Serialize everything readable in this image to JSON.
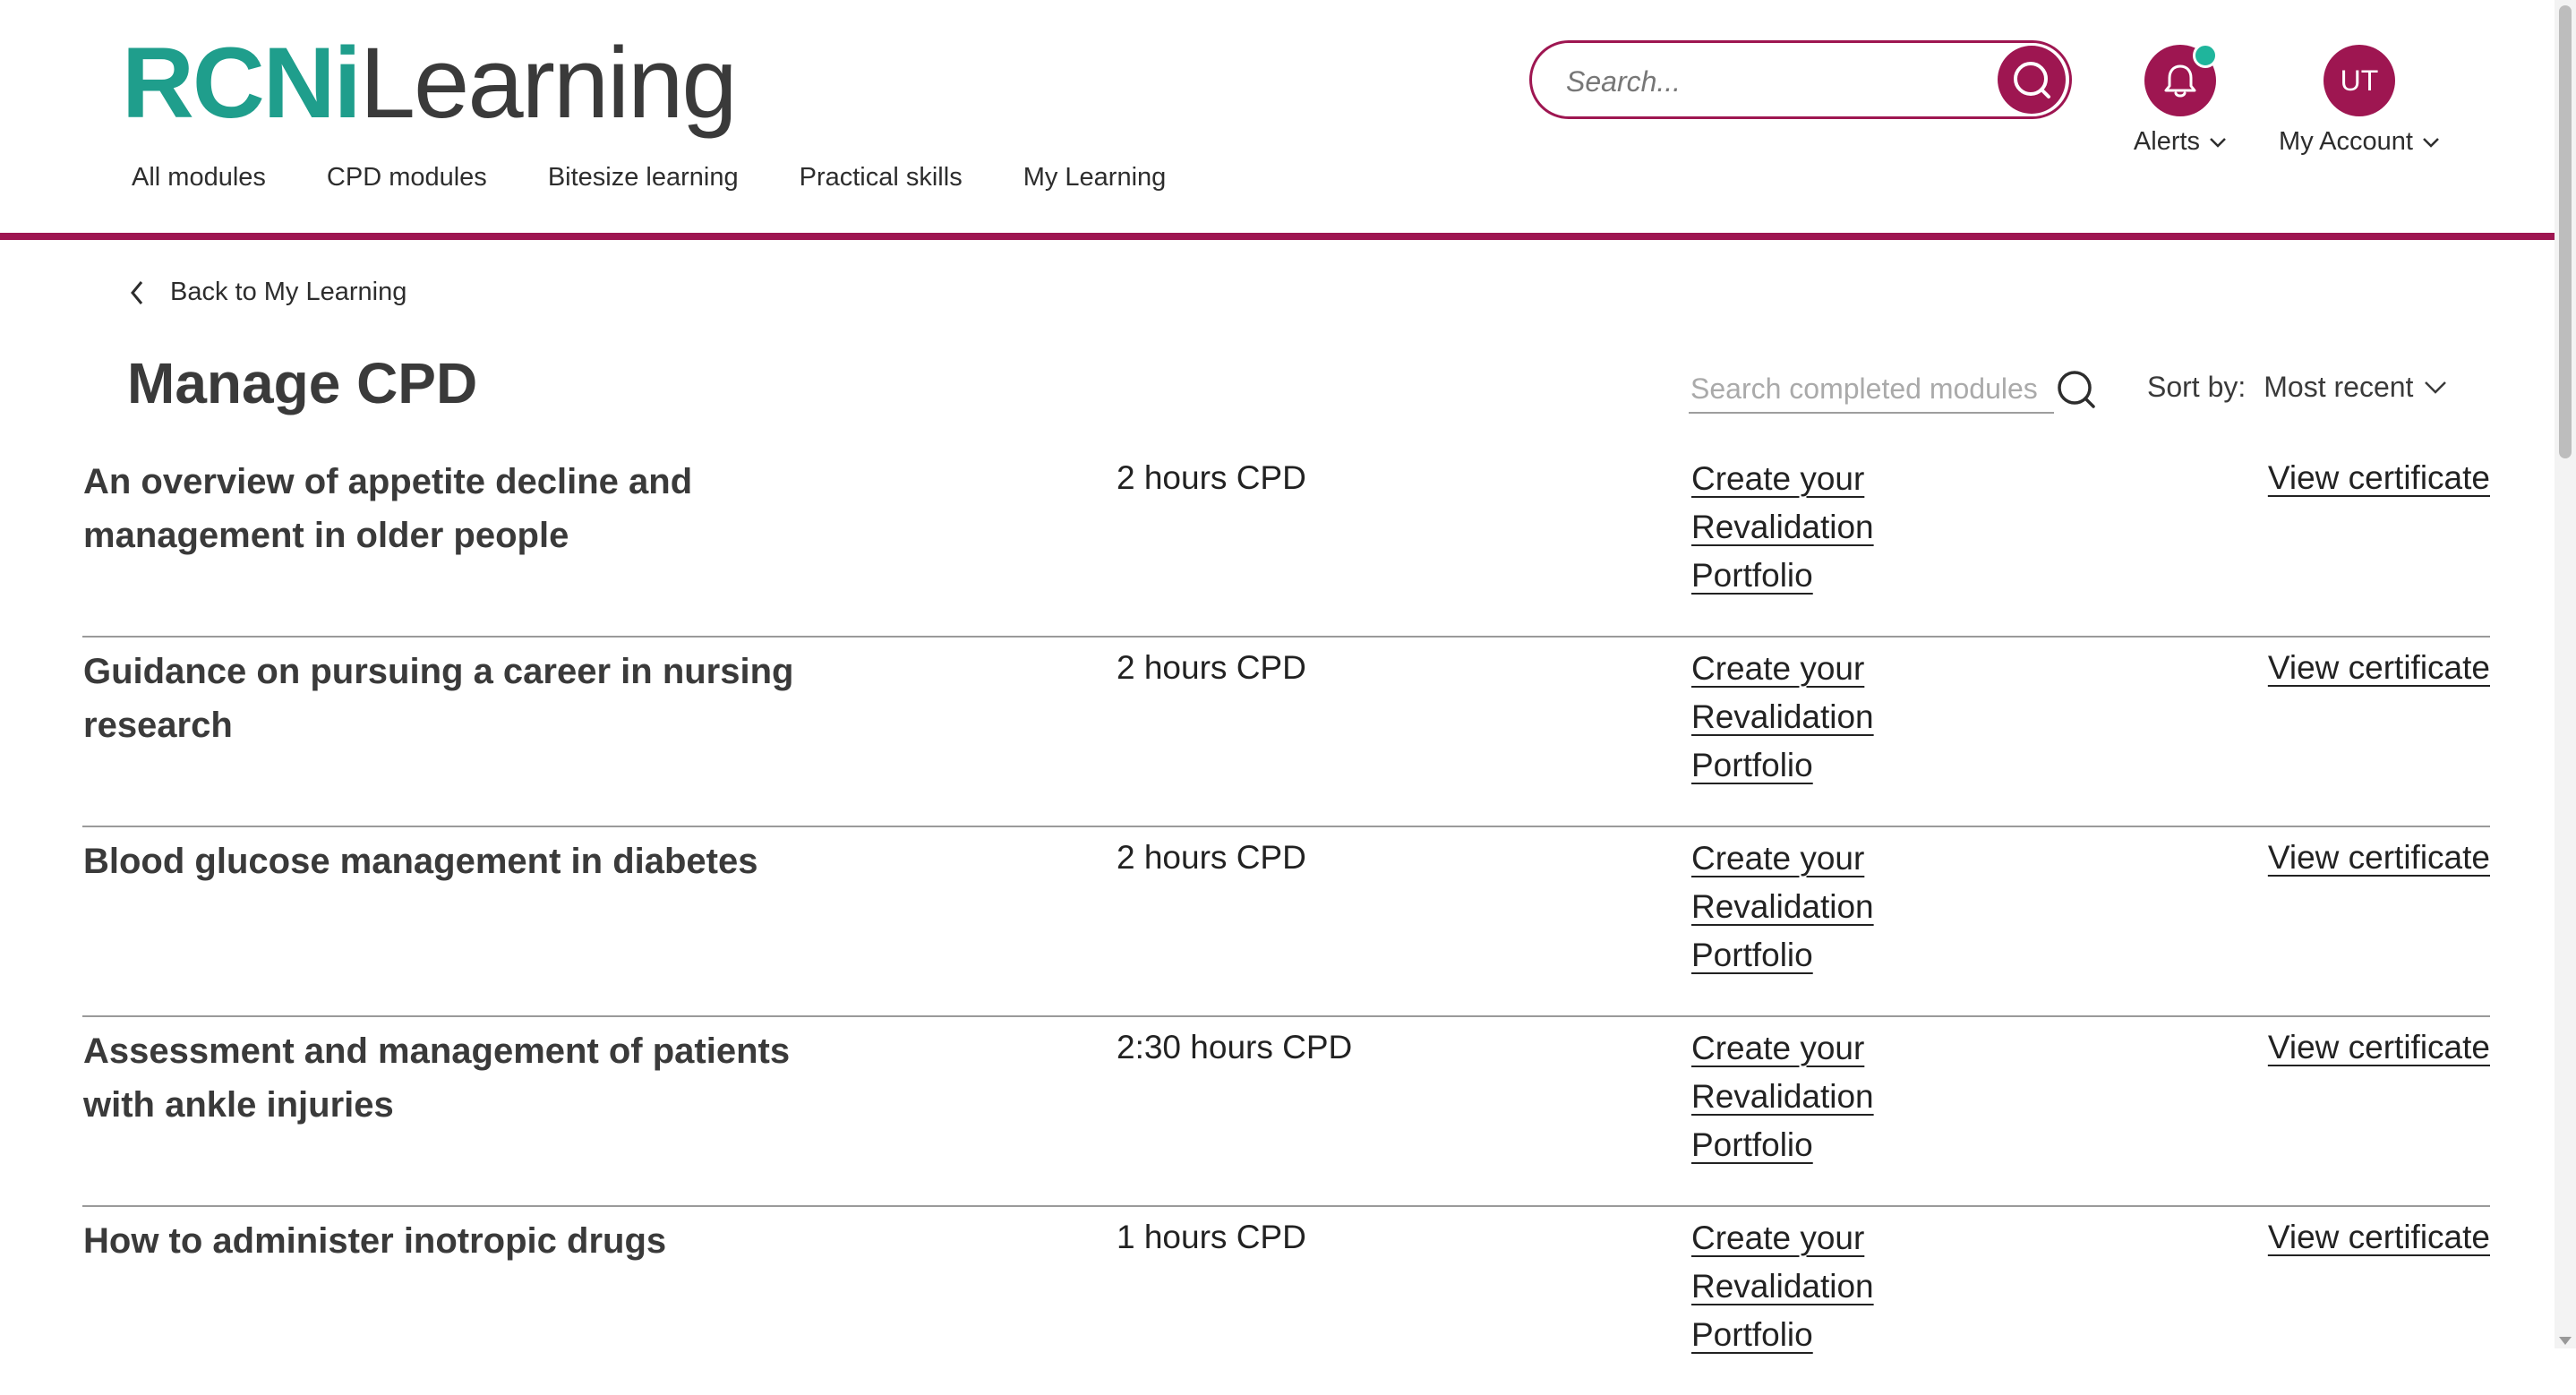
{
  "header": {
    "logo_brand": "RCNi",
    "logo_sub": "Learning",
    "nav": [
      {
        "label": "All modules"
      },
      {
        "label": "CPD modules"
      },
      {
        "label": "Bitesize learning"
      },
      {
        "label": "Practical skills"
      },
      {
        "label": "My Learning"
      }
    ],
    "search_placeholder": "Search...",
    "alerts_label": "Alerts",
    "account_label": "My Account",
    "account_initials": "UT"
  },
  "colors": {
    "brand_primary": "#9e1651",
    "brand_teal": "#1f9e8c",
    "notification_dot": "#1fb59c"
  },
  "back_link": "Back to My Learning",
  "page_title": "Manage CPD",
  "completed_search_placeholder": "Search completed modules",
  "sort": {
    "label": "Sort by:",
    "value": "Most recent"
  },
  "modules": [
    {
      "title": "An overview of appetite decline and management in older people",
      "cpd": "2 hours CPD",
      "revalidation": [
        "Create your",
        "Revalidation",
        "Portfolio"
      ],
      "certificate": "View certificate"
    },
    {
      "title": "Guidance on pursuing a career in nursing research",
      "cpd": "2 hours CPD",
      "revalidation": [
        "Create your",
        "Revalidation",
        "Portfolio"
      ],
      "certificate": "View certificate"
    },
    {
      "title": "Blood glucose management in diabetes",
      "cpd": "2 hours CPD",
      "revalidation": [
        "Create your",
        "Revalidation",
        "Portfolio"
      ],
      "certificate": "View certificate"
    },
    {
      "title": "Assessment and management of patients with ankle injuries",
      "cpd": "2:30 hours CPD",
      "revalidation": [
        "Create your",
        "Revalidation",
        "Portfolio"
      ],
      "certificate": "View certificate"
    },
    {
      "title": "How to administer inotropic drugs",
      "cpd": "1 hours CPD",
      "revalidation": [
        "Create your",
        "Revalidation",
        "Portfolio"
      ],
      "certificate": "View certificate"
    }
  ]
}
